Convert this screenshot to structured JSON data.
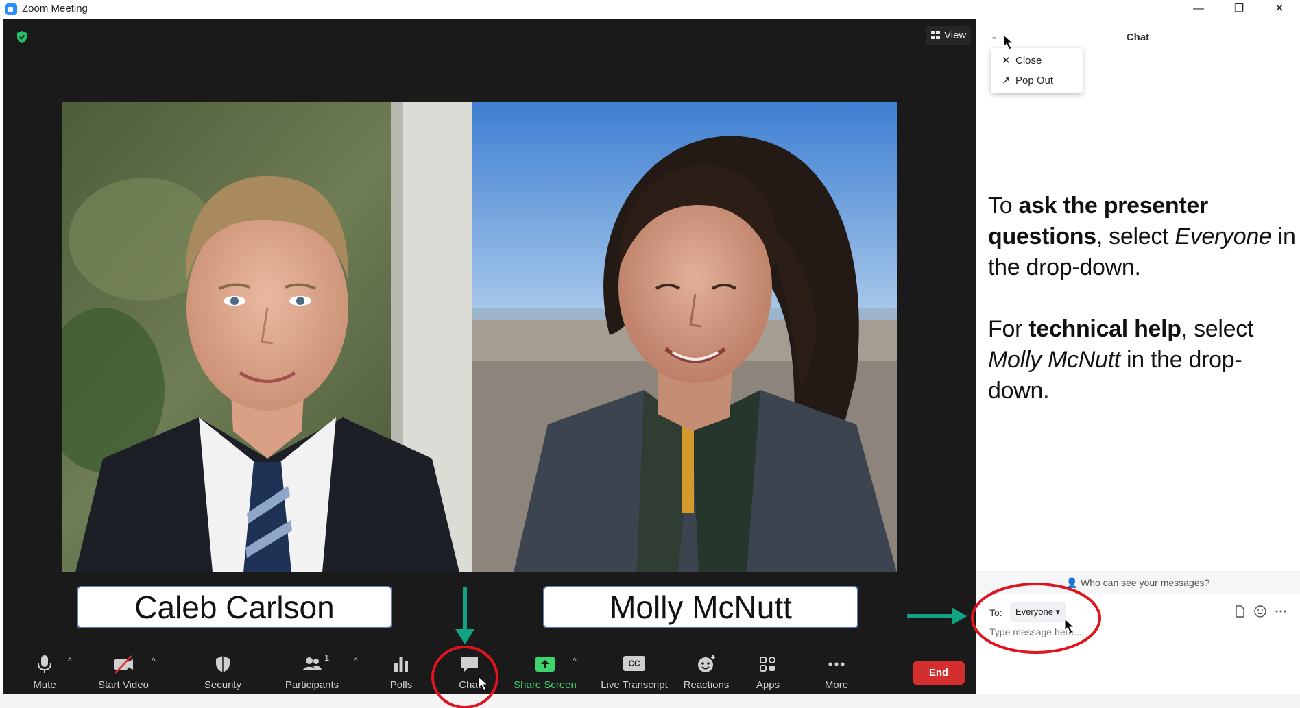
{
  "window": {
    "title": "Zoom Meeting",
    "minimize_glyph": "—",
    "restore_glyph": "❐",
    "close_glyph": "✕"
  },
  "meeting": {
    "view_label": "View",
    "participants": [
      {
        "name": "Caleb Carlson"
      },
      {
        "name": "Molly McNutt"
      }
    ]
  },
  "toolbar": {
    "mute": "Mute",
    "start_video": "Start Video",
    "security": "Security",
    "participants": "Participants",
    "participant_count": "1",
    "polls": "Polls",
    "chat": "Chat",
    "share_screen": "Share Screen",
    "live_transcript": "Live Transcript",
    "cc_glyph": "CC",
    "reactions": "Reactions",
    "apps": "Apps",
    "more": "More",
    "end": "End"
  },
  "chat": {
    "title": "Chat",
    "menu": {
      "close": "Close",
      "pop_out": "Pop Out"
    },
    "instructions": {
      "p1_pre": "To ",
      "p1_bold1": "ask the presenter questions",
      "p1_mid": ", select ",
      "p1_italic": "Everyone",
      "p1_post": " in the drop-down.",
      "p2_pre": "For ",
      "p2_bold": "technical help",
      "p2_mid": ", select ",
      "p2_italic": "Molly McNutt",
      "p2_post": " in the drop-down."
    },
    "privacy_text": "Who can see your messages?",
    "to_label": "To:",
    "recipient": "Everyone",
    "input_placeholder": "Type message here..."
  },
  "colors": {
    "meeting_bg": "#1a1a1a",
    "share_green": "#3fd46b",
    "end_red": "#d42e2e",
    "annotation_red": "#e0141e",
    "annotation_teal": "#13a383",
    "name_box_border": "#5b7fb5"
  },
  "icons": [
    "zoom-app-icon",
    "shield-check-icon",
    "grid-view-icon",
    "microphone-icon",
    "video-off-icon",
    "security-shield-icon",
    "participants-icon",
    "polls-icon",
    "chat-bubble-icon",
    "share-screen-icon",
    "cc-icon",
    "reactions-icon",
    "apps-icon",
    "more-dots-icon",
    "chevron-down-icon",
    "close-icon",
    "pop-out-icon",
    "file-icon",
    "emoji-icon",
    "ellipsis-icon",
    "cursor-icon"
  ]
}
